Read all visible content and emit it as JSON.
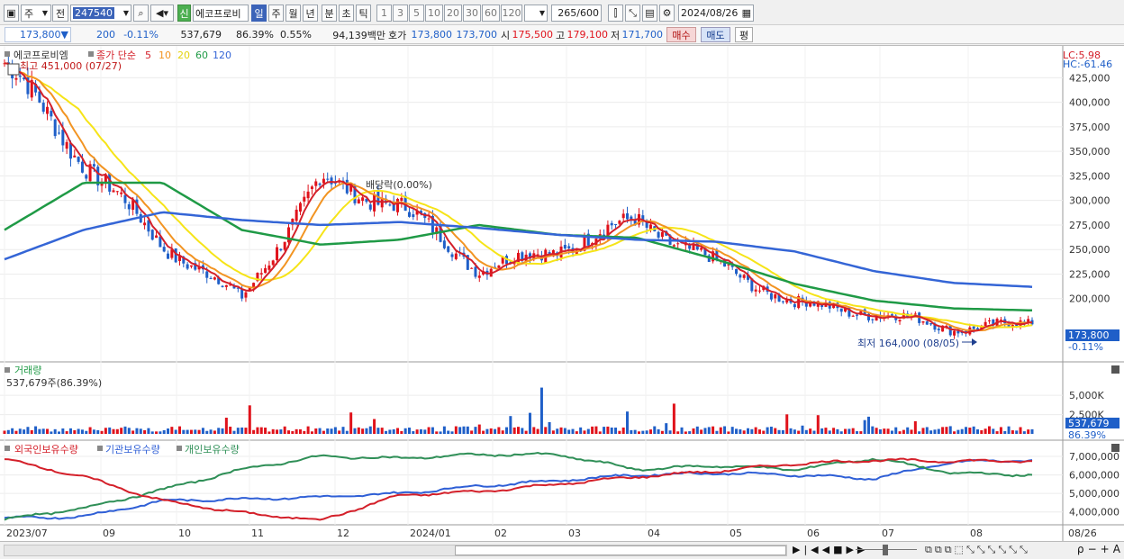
{
  "toolbar": {
    "period_select": "주",
    "prev_label": "전",
    "code": "247540",
    "name": "에코프로비",
    "shin_label": "신",
    "periods": [
      "일",
      "주",
      "월",
      "년",
      "분",
      "초",
      "틱"
    ],
    "intervals": [
      "1",
      "3",
      "5",
      "10",
      "20",
      "30",
      "60",
      "120"
    ],
    "count": "265",
    "count_total": "/600",
    "date": "2024/08/26"
  },
  "quote": {
    "price": "173,800",
    "change": "200",
    "change_pct": "-0.11%",
    "volume": "537,679",
    "vol_ratio": "86.39%",
    "turnover": "0.55%",
    "amount": "94,139백만",
    "hoga_label": "호가",
    "ask": "173,800",
    "bid": "173,700",
    "open_label": "시",
    "open": "175,500",
    "high_label": "고",
    "high": "179,100",
    "low_label": "저",
    "low": "171,700",
    "buy_label": "매수",
    "sell_label": "매도",
    "eval_label": "평"
  },
  "price_pane": {
    "legend_name": "에코프로비엠",
    "legend_type": "종가 단순",
    "ma_labels": [
      "5",
      "10",
      "20",
      "60",
      "120"
    ],
    "max_label": "최고 451,000 (07/27)",
    "min_label": "최저 164,000 (08/05)",
    "ex_rights": "배당락(0.00%)",
    "lc": "LC:5.98",
    "hc": "HC:-61.46",
    "y_ticks": [
      "425,000",
      "400,000",
      "375,000",
      "350,000",
      "325,000",
      "300,000",
      "275,000",
      "250,000",
      "225,000",
      "200,000"
    ],
    "current_price": "173,800",
    "current_change": "-0.11%"
  },
  "volume_pane": {
    "title": "거래량",
    "value_label": "537,679주(86.39%)",
    "y_ticks": [
      "5,000K",
      "2,500K"
    ],
    "current_volume": "537,679",
    "current_ratio": "86.39%"
  },
  "holding_pane": {
    "legend": [
      "외국인보유수량",
      "기관보유수량",
      "개인보유수량"
    ],
    "y_ticks": [
      "7,000,000",
      "6,000,000",
      "5,000,000",
      "4,000,000"
    ]
  },
  "x_axis": [
    "2023/07",
    "09",
    "10",
    "11",
    "12",
    "2024/01",
    "02",
    "03",
    "04",
    "05",
    "06",
    "07",
    "08"
  ],
  "x_axis_right": "08/26",
  "colors": {
    "up": "#e0121b",
    "down": "#1f5fc8",
    "ma5": "#d4202a",
    "ma10": "#f29422",
    "ma20": "#f6e418",
    "ma60": "#1f9a46",
    "ma120": "#3465d6",
    "foreign": "#d4202a",
    "institution": "#2f5fd6",
    "individual": "#2f8f57"
  },
  "chart_data": {
    "type": "line",
    "title": "에코프로비엠",
    "x": [
      "2023/07",
      "09",
      "10",
      "11",
      "12",
      "2024/01",
      "02",
      "03",
      "04",
      "05",
      "06",
      "07",
      "08",
      "08/26"
    ],
    "series": [
      {
        "name": "종가",
        "values": [
          440000,
          340000,
          255000,
          200000,
          320000,
          295000,
          230000,
          250000,
          280000,
          235000,
          195000,
          185000,
          170000,
          173800
        ]
      },
      {
        "name": "60",
        "values": [
          270000,
          318000,
          318000,
          270000,
          255000,
          260000,
          275000,
          265000,
          262000,
          240000,
          215000,
          198000,
          190000,
          188000
        ]
      },
      {
        "name": "120",
        "values": [
          240000,
          270000,
          288000,
          280000,
          275000,
          278000,
          272000,
          265000,
          260000,
          258000,
          248000,
          228000,
          216000,
          212000
        ]
      },
      {
        "name": "외국인보유수량",
        "values": [
          6850000,
          5900000,
          4600000,
          3950000,
          3550000,
          4900000,
          5100000,
          5500000,
          5900000,
          6200000,
          6600000,
          6800000,
          6750000,
          6750000
        ]
      },
      {
        "name": "기관보유수량",
        "values": [
          3650000,
          3750000,
          4600000,
          4700000,
          4800000,
          5000000,
          5400000,
          5700000,
          6000000,
          6100000,
          6000000,
          5800000,
          6700000,
          6800000
        ]
      },
      {
        "name": "개인보유수량",
        "values": [
          3600000,
          4200000,
          5200000,
          6300000,
          7000000,
          6900000,
          7100000,
          7100000,
          6300000,
          6500000,
          6300000,
          6900000,
          6100000,
          6000000
        ]
      }
    ],
    "ylim": [
      160000,
      451000
    ]
  }
}
